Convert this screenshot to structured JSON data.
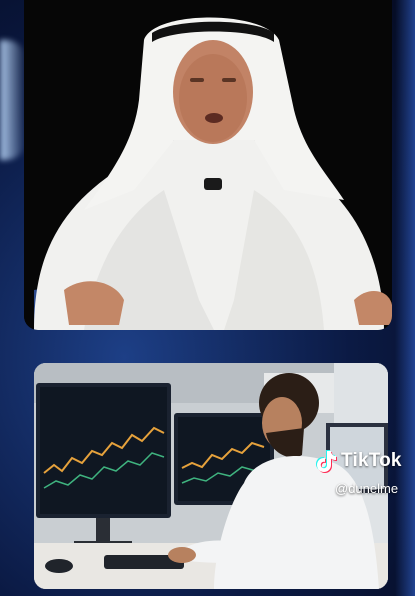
{
  "video_top": {
    "subject": "elderly-man-in-white-ghutra-icon"
  },
  "video_bottom": {
    "subject": "trader-at-monitors-icon"
  },
  "watermark": {
    "brand": "TikTok",
    "handle": "@dunelme",
    "icon": "tiktok-note-icon"
  },
  "colors": {
    "background": "#0b1a44",
    "accent_blue": "#1d3f86",
    "text": "#ffffff"
  }
}
